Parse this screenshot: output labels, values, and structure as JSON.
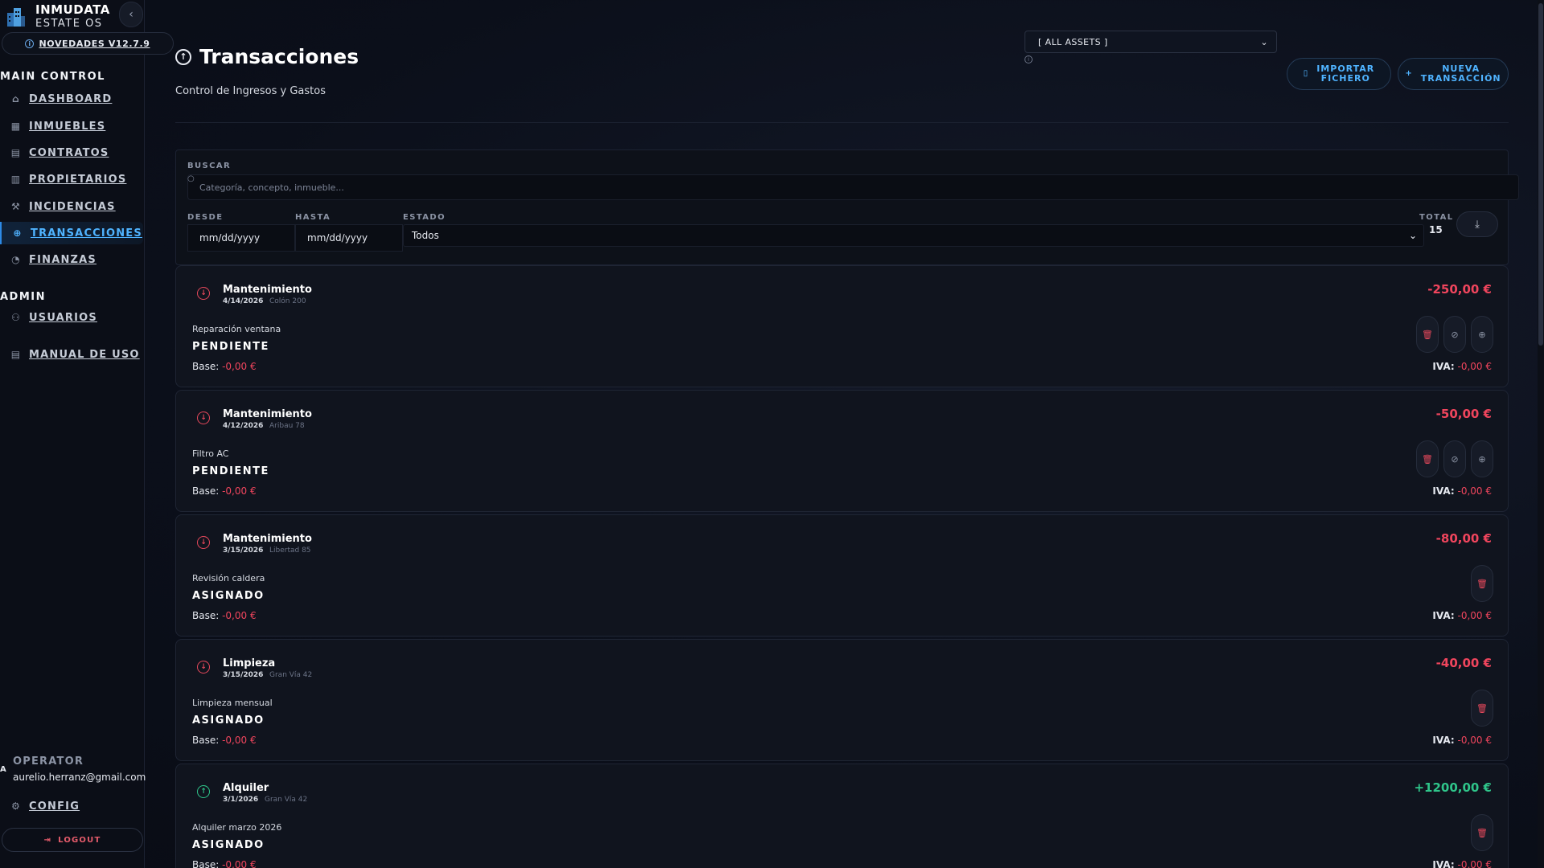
{
  "brand": {
    "title": "INMUDATA",
    "subtitle": "ESTATE OS",
    "version_label": "NOVEDADES V12.7.9"
  },
  "sidebar": {
    "sections": [
      {
        "label": "MAIN CONTROL"
      },
      {
        "label": "ADMIN"
      }
    ],
    "main_items": [
      {
        "label": "DASHBOARD",
        "icon": "home-icon"
      },
      {
        "label": "INMUEBLES",
        "icon": "building-icon"
      },
      {
        "label": "CONTRATOS",
        "icon": "document-icon"
      },
      {
        "label": "PROPIETARIOS",
        "icon": "owners-icon"
      },
      {
        "label": "INCIDENCIAS",
        "icon": "wrench-icon"
      },
      {
        "label": "TRANSACCIONES",
        "icon": "transactions-icon",
        "active": true
      },
      {
        "label": "FINANZAS",
        "icon": "pie-chart-icon"
      }
    ],
    "admin_items": [
      {
        "label": "USUARIOS",
        "icon": "users-icon"
      },
      {
        "label": "MANUAL DE USO",
        "icon": "manual-icon"
      }
    ],
    "operator_label": "OPERATOR",
    "operator_mark": "A",
    "operator_email": "aurelio.herranz@gmail.com",
    "config_label": "CONFIG",
    "logout_label": "LOGOUT"
  },
  "header": {
    "title": "Transacciones",
    "subtitle": "Control de Ingresos y Gastos",
    "asset_filter": "[ ALL ASSETS ]",
    "import_label_1": "IMPORTAR",
    "import_label_2": "FICHERO",
    "new_label_1": "NUEVA",
    "new_label_2": "TRANSACCIÓN"
  },
  "filters": {
    "search_label": "BUSCAR",
    "search_placeholder": "Categoría, concepto, inmueble...",
    "from_label": "DESDE",
    "to_label": "HASTA",
    "status_label": "ESTADO",
    "from_value": "mm/dd/yyyy",
    "to_value": "mm/dd/yyyy",
    "status_value": "Todos",
    "total_label": "TOTAL",
    "total_value": "15"
  },
  "colors": {
    "negative": "#f0455d",
    "positive": "#2fc58a",
    "accent": "#4fb3ff"
  },
  "transactions": [
    {
      "category": "Mantenimiento",
      "date": "4/14/2026",
      "property": "Colón 200",
      "amount": "-250,00 €",
      "concept": "Reparación ventana",
      "status": "PENDIENTE",
      "base_label": "Base:",
      "base": "-0,00 €",
      "iva_label": "IVA:",
      "iva": "-0,00 €",
      "kind": "neg",
      "actions": [
        "delete",
        "cancel",
        "assign"
      ]
    },
    {
      "category": "Mantenimiento",
      "date": "4/12/2026",
      "property": "Aribau 78",
      "amount": "-50,00 €",
      "concept": "Filtro AC",
      "status": "PENDIENTE",
      "base_label": "Base:",
      "base": "-0,00 €",
      "iva_label": "IVA:",
      "iva": "-0,00 €",
      "kind": "neg",
      "actions": [
        "delete",
        "cancel",
        "assign"
      ]
    },
    {
      "category": "Mantenimiento",
      "date": "3/15/2026",
      "property": "Libertad 85",
      "amount": "-80,00 €",
      "concept": "Revisión caldera",
      "status": "ASIGNADO",
      "base_label": "Base:",
      "base": "-0,00 €",
      "iva_label": "IVA:",
      "iva": "-0,00 €",
      "kind": "neg",
      "actions": [
        "delete"
      ]
    },
    {
      "category": "Limpieza",
      "date": "3/15/2026",
      "property": "Gran Vía 42",
      "amount": "-40,00 €",
      "concept": "Limpieza mensual",
      "status": "ASIGNADO",
      "base_label": "Base:",
      "base": "-0,00 €",
      "iva_label": "IVA:",
      "iva": "-0,00 €",
      "kind": "neg",
      "actions": [
        "delete"
      ]
    },
    {
      "category": "Alquiler",
      "date": "3/1/2026",
      "property": "Gran Vía 42",
      "amount": "+1200,00 €",
      "concept": "Alquiler marzo 2026",
      "status": "ASIGNADO",
      "base_label": "Base:",
      "base": "-0,00 €",
      "iva_label": "IVA:",
      "iva": "-0,00 €",
      "kind": "pos",
      "actions": [
        "delete"
      ]
    }
  ]
}
